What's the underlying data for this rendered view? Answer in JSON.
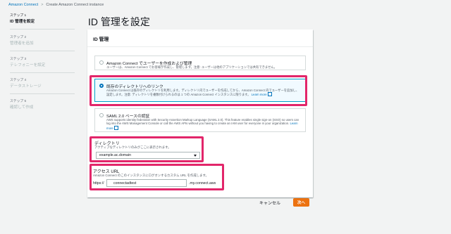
{
  "breadcrumb": {
    "root": "Amazon Connect",
    "current": "Create Amazon Connect instance"
  },
  "steps": [
    {
      "num": "ステップ 1",
      "title": "ID 管理を設定",
      "active": true
    },
    {
      "num": "ステップ 2",
      "title": "管理者を追加",
      "active": false
    },
    {
      "num": "ステップ 3",
      "title": "テレフォニーを設定",
      "active": false
    },
    {
      "num": "ステップ 4",
      "title": "データストレージ",
      "active": false
    },
    {
      "num": "ステップ 5",
      "title": "確認して作成",
      "active": false
    }
  ],
  "page_title": "ID 管理を設定",
  "panel": {
    "header": "ID 管理",
    "options": [
      {
        "title": "Amazon Connect でユーザーを作成および管理",
        "desc": "ユーザーは、Amazon Connect でお客様が作成し、管理します。注意: ユーザーは他のアプリケーションでは共有できません。",
        "selected": false
      },
      {
        "title": "既存のディレクトリへのリンク",
        "desc": "Amazon Connect は既存のディレクトリを利用します。ディレクトリ内でユーザーを作成してから、Amazon Connect 内でユーザーを追加し、設定します。注意: ディレクトリを複数付けられるのは 1 つの Amazon Connect インスタンスに限ります。",
        "learn_more": "Learn more",
        "selected": true
      },
      {
        "title": "SAML 2.0 ベースの認証",
        "desc": "AWS supports identity federation with Security Assertion Markup Language (SAML 2.0). This feature enables single sign-on (SSO) so users can log into the AWS Management Console or call the AWS APIs without you having to create an IAM user for everyone in your organization.",
        "learn_more": "Learn more",
        "selected": false
      }
    ]
  },
  "directory": {
    "label": "ディレクトリ",
    "desc": "アクティブなディレクトリのみがここに表示されます。",
    "value": "example.ac.domain"
  },
  "access_url": {
    "label": "アクセス URL",
    "desc": "Amazon Connect のこのインスタンスにログオンするカスタム URL を作成します。",
    "prefix": "https://",
    "value": "connectadtest",
    "suffix": ".my.connect.aws"
  },
  "actions": {
    "cancel": "キャンセル",
    "next": "次へ"
  },
  "colors": {
    "accent": "#0073bb",
    "primary_button": "#ec7211",
    "highlight": "#e2266a"
  }
}
